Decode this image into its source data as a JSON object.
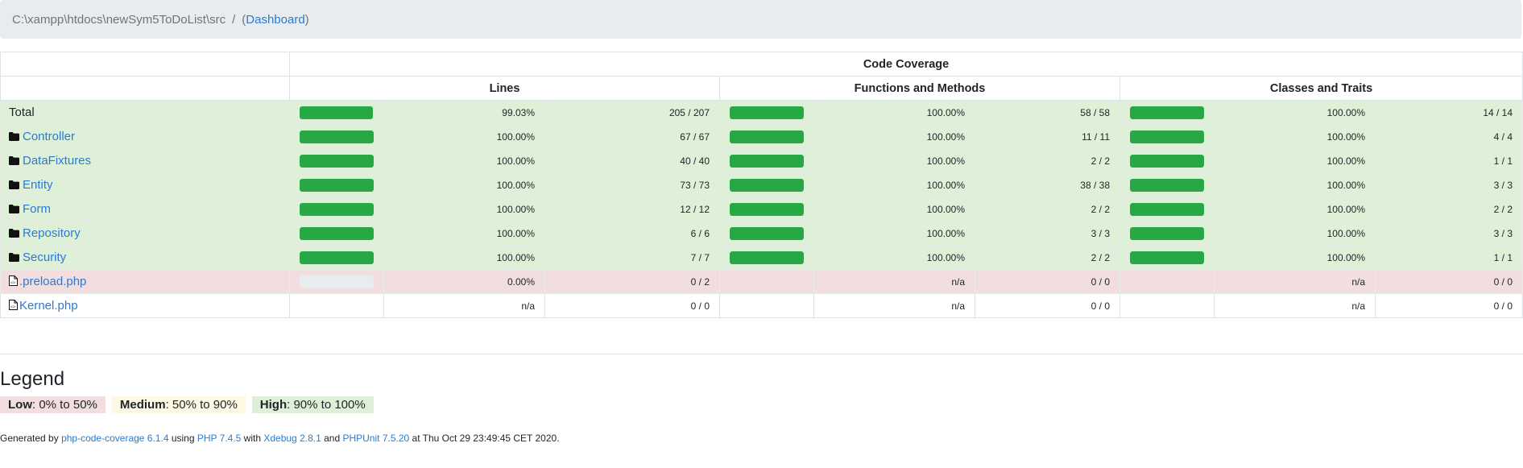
{
  "breadcrumb": {
    "path": "C:\\xampp\\htdocs\\newSym5ToDoList\\src",
    "separator": "/",
    "open_paren": "(",
    "dashboard_link": "Dashboard",
    "close_paren": ")"
  },
  "table": {
    "header_group": "Code Coverage",
    "columns": [
      "Lines",
      "Functions and Methods",
      "Classes and Traits"
    ],
    "colors": {
      "high": "#dff0d8",
      "low": "#f2dede",
      "bar": "#28a745"
    },
    "rows": [
      {
        "name": "Total",
        "icon": "",
        "link": false,
        "status": "success",
        "lines_pct": "99.03%",
        "lines_count": "205 / 207",
        "lines_level": 99.03,
        "funcs_pct": "100.00%",
        "funcs_count": "58 / 58",
        "funcs_level": 100,
        "classes_pct": "100.00%",
        "classes_count": "14 / 14",
        "classes_level": 100
      },
      {
        "name": "Controller",
        "icon": "folder-icon",
        "link": true,
        "status": "success",
        "lines_pct": "100.00%",
        "lines_count": "67 / 67",
        "lines_level": 100,
        "funcs_pct": "100.00%",
        "funcs_count": "11 / 11",
        "funcs_level": 100,
        "classes_pct": "100.00%",
        "classes_count": "4 / 4",
        "classes_level": 100
      },
      {
        "name": "DataFixtures",
        "icon": "folder-icon",
        "link": true,
        "status": "success",
        "lines_pct": "100.00%",
        "lines_count": "40 / 40",
        "lines_level": 100,
        "funcs_pct": "100.00%",
        "funcs_count": "2 / 2",
        "funcs_level": 100,
        "classes_pct": "100.00%",
        "classes_count": "1 / 1",
        "classes_level": 100
      },
      {
        "name": "Entity",
        "icon": "folder-icon",
        "link": true,
        "status": "success",
        "lines_pct": "100.00%",
        "lines_count": "73 / 73",
        "lines_level": 100,
        "funcs_pct": "100.00%",
        "funcs_count": "38 / 38",
        "funcs_level": 100,
        "classes_pct": "100.00%",
        "classes_count": "3 / 3",
        "classes_level": 100
      },
      {
        "name": "Form",
        "icon": "folder-icon",
        "link": true,
        "status": "success",
        "lines_pct": "100.00%",
        "lines_count": "12 / 12",
        "lines_level": 100,
        "funcs_pct": "100.00%",
        "funcs_count": "2 / 2",
        "funcs_level": 100,
        "classes_pct": "100.00%",
        "classes_count": "2 / 2",
        "classes_level": 100
      },
      {
        "name": "Repository",
        "icon": "folder-icon",
        "link": true,
        "status": "success",
        "lines_pct": "100.00%",
        "lines_count": "6 / 6",
        "lines_level": 100,
        "funcs_pct": "100.00%",
        "funcs_count": "3 / 3",
        "funcs_level": 100,
        "classes_pct": "100.00%",
        "classes_count": "3 / 3",
        "classes_level": 100
      },
      {
        "name": "Security",
        "icon": "folder-icon",
        "link": true,
        "status": "success",
        "lines_pct": "100.00%",
        "lines_count": "7 / 7",
        "lines_level": 100,
        "funcs_pct": "100.00%",
        "funcs_count": "2 / 2",
        "funcs_level": 100,
        "classes_pct": "100.00%",
        "classes_count": "1 / 1",
        "classes_level": 100
      },
      {
        "name": ".preload.php",
        "icon": "file-code-icon",
        "link": true,
        "status": "danger",
        "lines_pct": "0.00%",
        "lines_count": "0 / 2",
        "lines_level": 0,
        "funcs_pct": "n/a",
        "funcs_count": "0 / 0",
        "funcs_level": null,
        "classes_pct": "n/a",
        "classes_count": "0 / 0",
        "classes_level": null
      },
      {
        "name": "Kernel.php",
        "icon": "file-code-icon",
        "link": true,
        "status": "",
        "lines_pct": "n/a",
        "lines_count": "0 / 0",
        "lines_level": null,
        "funcs_pct": "n/a",
        "funcs_count": "0 / 0",
        "funcs_level": null,
        "classes_pct": "n/a",
        "classes_count": "0 / 0",
        "classes_level": null
      }
    ]
  },
  "legend": {
    "title": "Legend",
    "low_label": "Low",
    "low_range": ": 0% to 50%",
    "medium_label": "Medium",
    "medium_range": ": 50% to 90%",
    "high_label": "High",
    "high_range": ": 90% to 100%"
  },
  "footer": {
    "prefix": "Generated by ",
    "tool": "php-code-coverage 6.1.4",
    "using": " using ",
    "php": "PHP 7.4.5",
    "with": " with ",
    "xdebug": "Xdebug 2.8.1",
    "and": " and ",
    "phpunit": "PHPUnit 7.5.20",
    "suffix": " at Thu Oct 29 23:49:45 CET 2020."
  }
}
